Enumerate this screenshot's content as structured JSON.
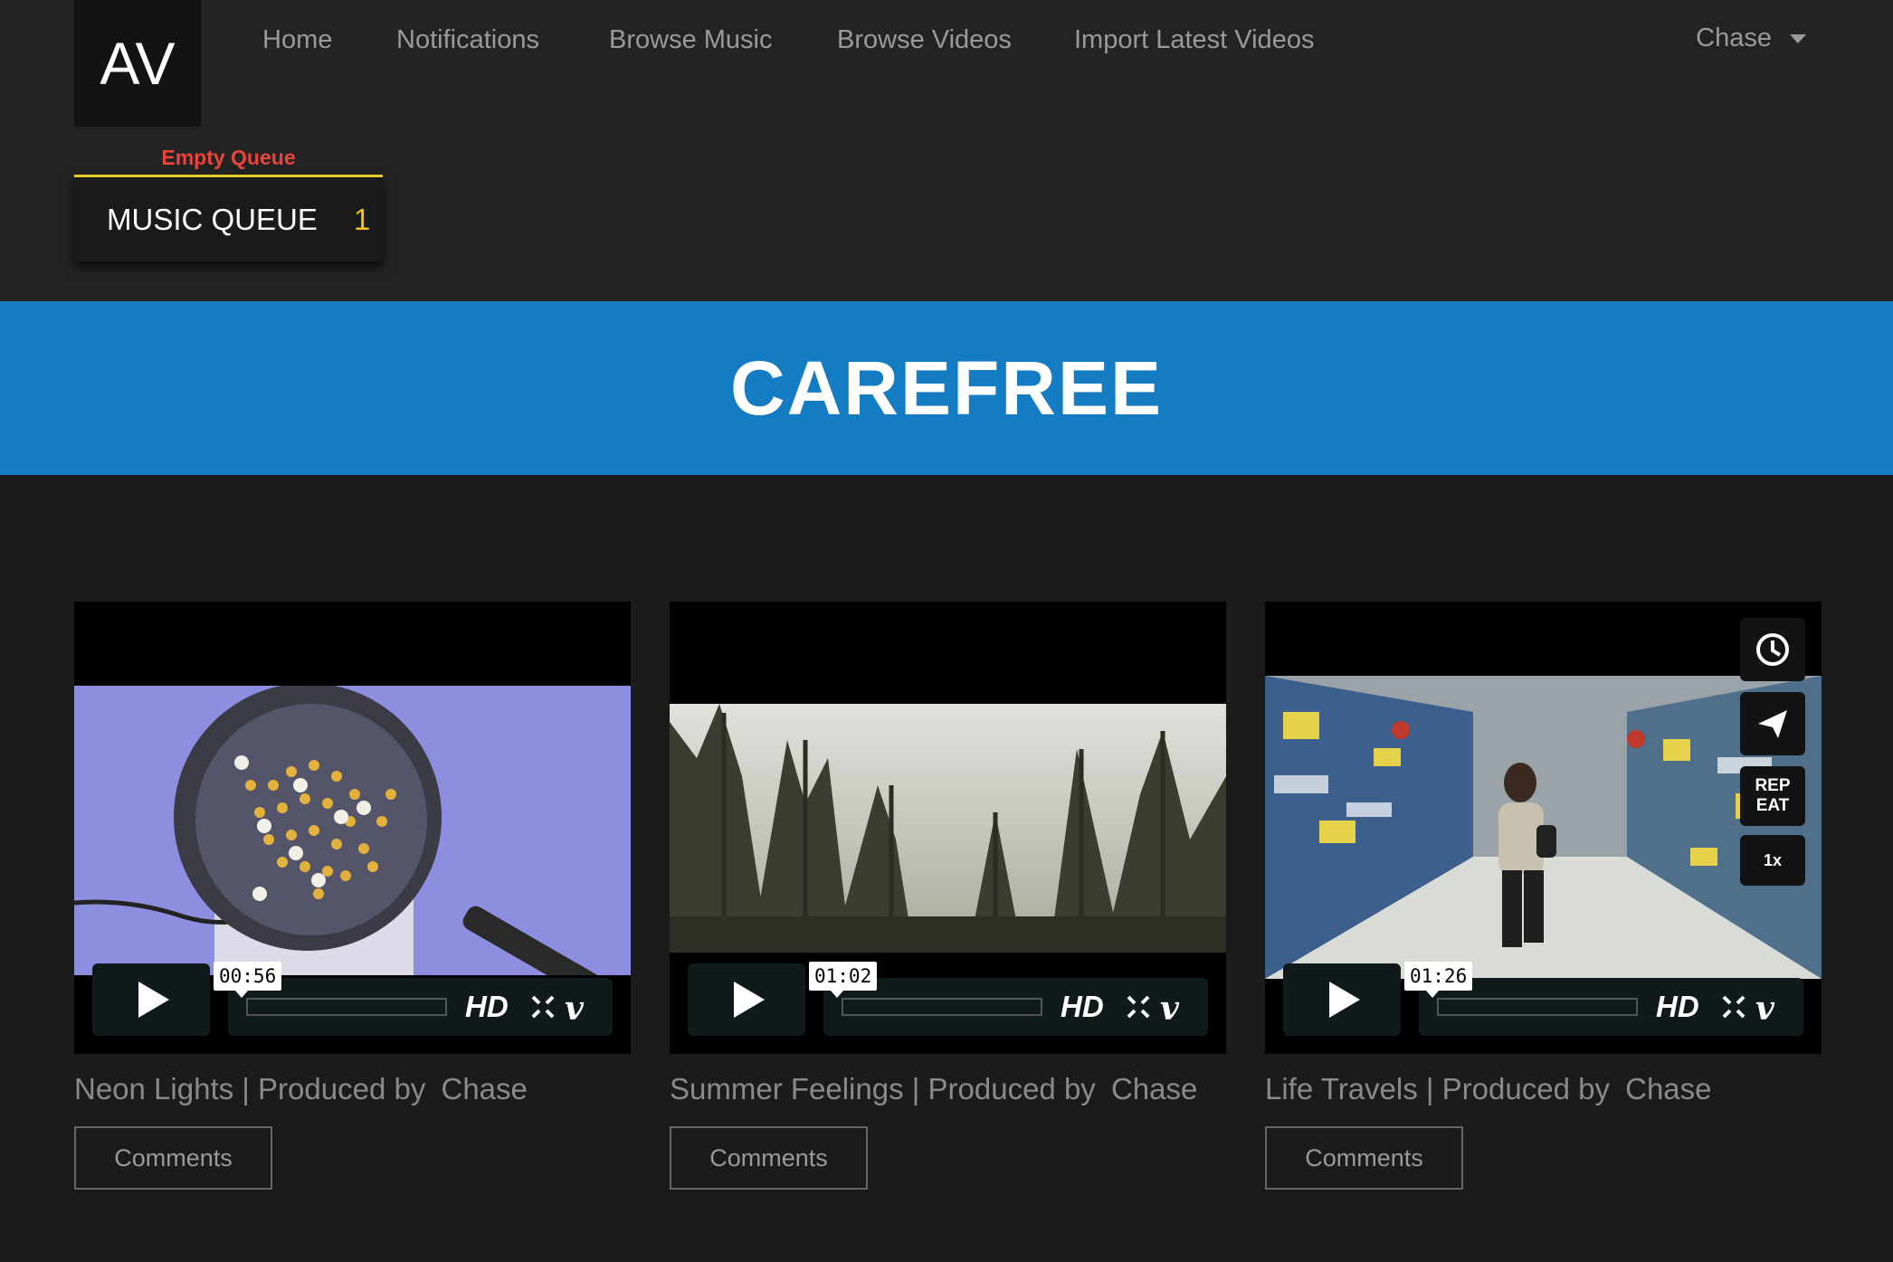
{
  "brand": {
    "logo_text": "AV"
  },
  "nav": {
    "items": [
      {
        "label": "Home"
      },
      {
        "label": "Notifications"
      },
      {
        "label": "Browse Music"
      },
      {
        "label": "Browse Videos"
      },
      {
        "label": "Import Latest Videos"
      }
    ],
    "user": {
      "name": "Chase",
      "icon": "chevron-down-icon"
    }
  },
  "queue": {
    "empty_label": "Empty Queue",
    "title": "MUSIC QUEUE",
    "count": "1"
  },
  "banner": {
    "title": "CAREFREE"
  },
  "colors": {
    "banner": "#147cc2",
    "queue_accent": "#e8c92a",
    "empty_queue": "#e8453c",
    "queue_count": "#f2c21b"
  },
  "videos": [
    {
      "title": "Neon Lights",
      "produced_by": "| Produced by",
      "producer": "Chase",
      "timecode": "00:56",
      "hd": "HD",
      "comments": "Comments"
    },
    {
      "title": "Summer Feelings",
      "produced_by": "| Produced by",
      "producer": "Chase",
      "timecode": "01:02",
      "hd": "HD",
      "comments": "Comments"
    },
    {
      "title": "Life Travels",
      "produced_by": "| Produced by",
      "producer": "Chase",
      "timecode": "01:26",
      "hd": "HD",
      "comments": "Comments",
      "side_controls": {
        "repeat": "REP EAT",
        "speed": "1x"
      }
    }
  ]
}
